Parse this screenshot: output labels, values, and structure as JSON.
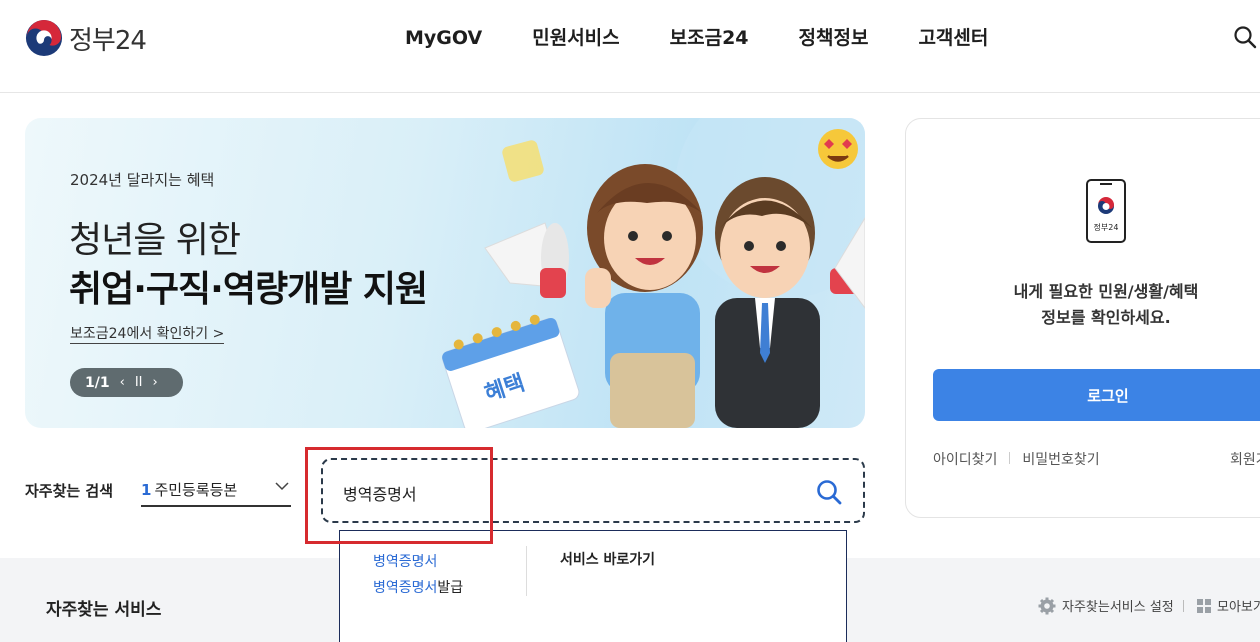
{
  "header": {
    "logo_text": "정부24",
    "nav": [
      "MyGOV",
      "민원서비스",
      "보조금24",
      "정책정보",
      "고객센터"
    ]
  },
  "banner": {
    "subtitle": "2024년 달라지는 혜택",
    "title_line1": "청년을 위한",
    "title_line2": "취업·구직·역량개발 지원",
    "link_text": "보조금24에서 확인하기 >",
    "counter": "1/1",
    "prev": "‹",
    "pause": "II",
    "next": "›",
    "calendar_text": "혜택"
  },
  "login": {
    "phone_label": "정부24",
    "message": "내게 필요한 민원/생활/혜택\n정보를 확인하세요.",
    "button": "로그인",
    "find_id": "아이디찾기",
    "find_pw": "비밀번호찾기",
    "join": "회원가"
  },
  "frequent_search": {
    "label": "자주찾는 검색",
    "rank": "1",
    "item": "주민등록등본"
  },
  "search": {
    "value": "병역증명서"
  },
  "autocomplete": {
    "items": [
      {
        "highlight": "병역증명서",
        "rest": ""
      },
      {
        "highlight": "병역증명서",
        "rest": "발급"
      }
    ],
    "shortcut_title": "서비스 바로가기"
  },
  "services": {
    "title": "자주찾는 서비스",
    "settings": "자주찾는서비스 설정",
    "collect": "모아보기"
  },
  "colors": {
    "accent": "#3c83e5",
    "highlight": "#2a6ad4",
    "annotation_red": "#d62a2f"
  }
}
